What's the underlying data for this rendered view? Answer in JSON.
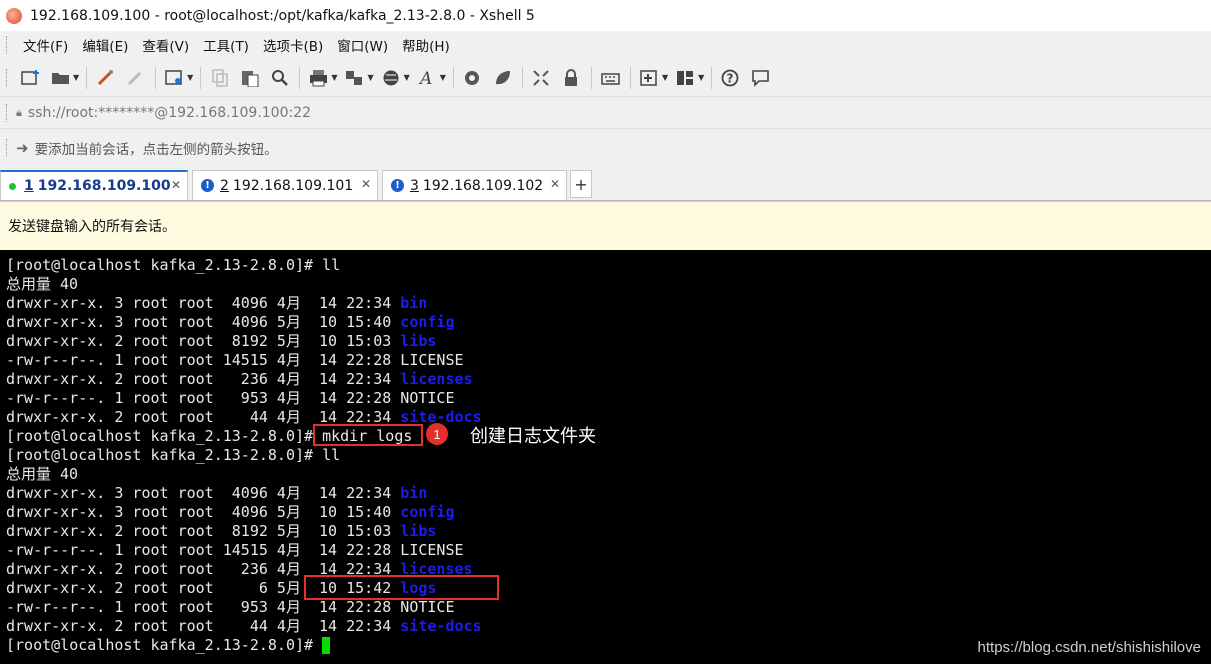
{
  "window": {
    "title": "192.168.109.100 - root@localhost:/opt/kafka/kafka_2.13-2.8.0 - Xshell 5"
  },
  "menu": [
    "文件(F)",
    "编辑(E)",
    "查看(V)",
    "工具(T)",
    "选项卡(B)",
    "窗口(W)",
    "帮助(H)"
  ],
  "toolbar_icons": [
    "new-session-icon",
    "open-folder-icon",
    "reconnect-icon",
    "disconnect-icon",
    "properties-icon",
    "copy-icon",
    "paste-icon",
    "find-icon",
    "print-icon",
    "transfer-icon",
    "globe-icon",
    "font-icon",
    "xftp-icon",
    "xmanager-icon",
    "fullscreen-icon",
    "lock-icon",
    "keyboard-icon",
    "add-tab-icon",
    "layout-icon",
    "help-icon",
    "chat-icon"
  ],
  "address": {
    "value": "ssh://root:********@192.168.109.100:22"
  },
  "hint": {
    "text": "要添加当前会话，点击左侧的箭头按钮。"
  },
  "tabs": [
    {
      "num": "1",
      "label": "192.168.109.100",
      "active": true
    },
    {
      "num": "2",
      "label": "192.168.109.101",
      "active": false
    },
    {
      "num": "3",
      "label": "192.168.109.102",
      "active": false
    }
  ],
  "compose": {
    "text": "发送键盘输入的所有会话。"
  },
  "terminal": {
    "lines": [
      {
        "plain": "[root@localhost kafka_2.13-2.8.0]# ll",
        "name": ""
      },
      {
        "plain": "总用量 40",
        "name": ""
      },
      {
        "plain": "drwxr-xr-x. 3 root root  4096 4月  14 22:34 ",
        "name": "bin"
      },
      {
        "plain": "drwxr-xr-x. 3 root root  4096 5月  10 15:40 ",
        "name": "config"
      },
      {
        "plain": "drwxr-xr-x. 2 root root  8192 5月  10 15:03 ",
        "name": "libs"
      },
      {
        "plain": "-rw-r--r--. 1 root root 14515 4月  14 22:28 LICENSE",
        "name": ""
      },
      {
        "plain": "drwxr-xr-x. 2 root root   236 4月  14 22:34 ",
        "name": "licenses"
      },
      {
        "plain": "-rw-r--r--. 1 root root   953 4月  14 22:28 NOTICE",
        "name": ""
      },
      {
        "plain": "drwxr-xr-x. 2 root root    44 4月  14 22:34 ",
        "name": "site-docs"
      },
      {
        "plain": "[root@localhost kafka_2.13-2.8.0]# mkdir logs",
        "name": ""
      },
      {
        "plain": "[root@localhost kafka_2.13-2.8.0]# ll",
        "name": ""
      },
      {
        "plain": "总用量 40",
        "name": ""
      },
      {
        "plain": "drwxr-xr-x. 3 root root  4096 4月  14 22:34 ",
        "name": "bin"
      },
      {
        "plain": "drwxr-xr-x. 3 root root  4096 5月  10 15:40 ",
        "name": "config"
      },
      {
        "plain": "drwxr-xr-x. 2 root root  8192 5月  10 15:03 ",
        "name": "libs"
      },
      {
        "plain": "-rw-r--r--. 1 root root 14515 4月  14 22:28 LICENSE",
        "name": ""
      },
      {
        "plain": "drwxr-xr-x. 2 root root   236 4月  14 22:34 ",
        "name": "licenses"
      },
      {
        "plain": "drwxr-xr-x. 2 root root     6 5月  10 15:42 ",
        "name": "logs"
      },
      {
        "plain": "-rw-r--r--. 1 root root   953 4月  14 22:28 NOTICE",
        "name": ""
      },
      {
        "plain": "drwxr-xr-x. 2 root root    44 4月  14 22:34 ",
        "name": "site-docs"
      },
      {
        "plain": "[root@localhost kafka_2.13-2.8.0]# ",
        "name": ""
      }
    ]
  },
  "annotation": {
    "badge": "1",
    "text": "创建日志文件夹"
  },
  "watermark": "https://blog.csdn.net/shishishilove",
  "colors": {
    "dir_blue": "#1c1cf0",
    "highlight_red": "#e5302a",
    "cursor_green": "#00e000",
    "compose_bg": "#fefbe0"
  }
}
